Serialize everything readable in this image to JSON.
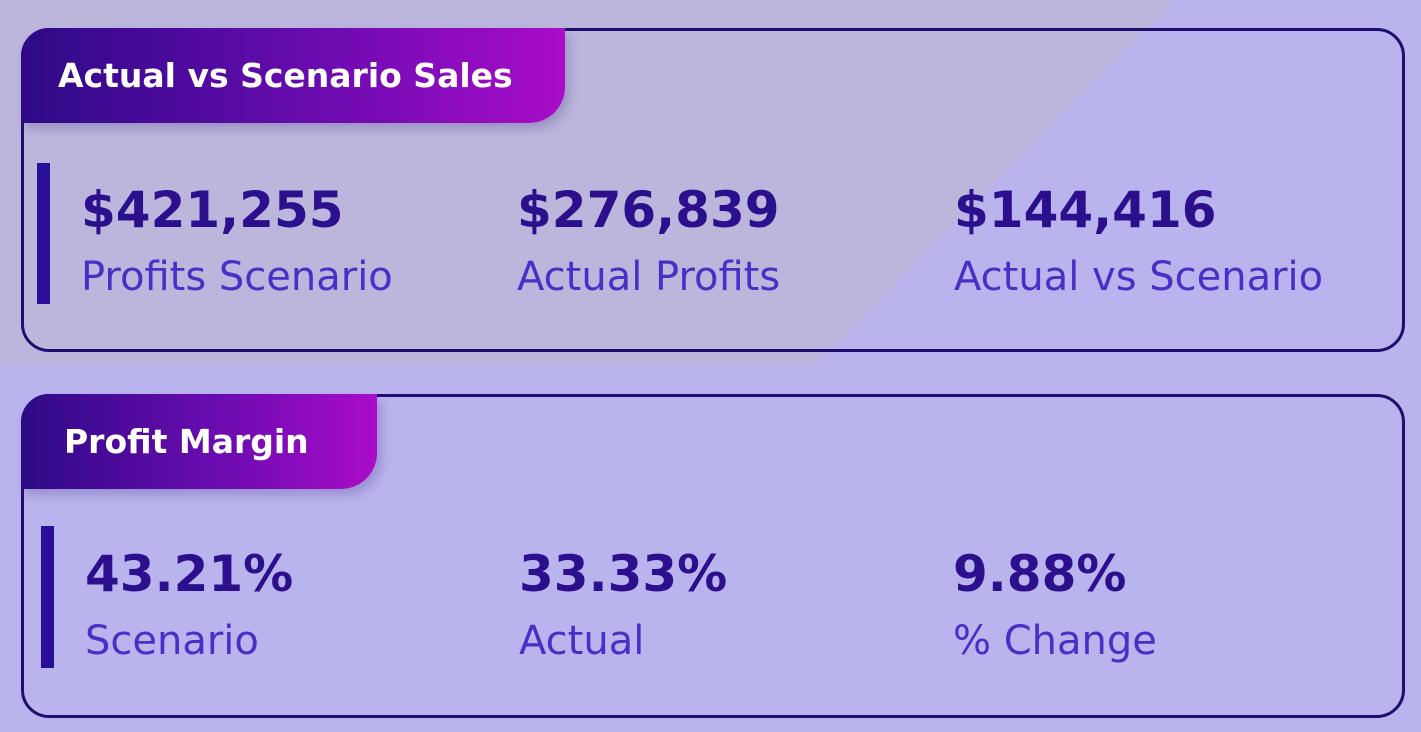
{
  "cards": [
    {
      "title": "Actual vs Scenario Sales",
      "metrics": [
        {
          "value": "$421,255",
          "label": "Profits Scenario"
        },
        {
          "value": "$276,839",
          "label": "Actual Profits"
        },
        {
          "value": "$144,416",
          "label": "Actual vs Scenario"
        }
      ]
    },
    {
      "title": "Profit Margin",
      "metrics": [
        {
          "value": "43.21%",
          "label": "Scenario"
        },
        {
          "value": "33.33%",
          "label": "Actual"
        },
        {
          "value": "9.88%",
          "label": "% Change"
        }
      ]
    }
  ],
  "colors": {
    "background": "#b9b3ee",
    "border": "#1e0f6e",
    "value_text": "#2c0f8c",
    "label_text": "#4a2fc6",
    "tag_gradient_start": "#2d0a86",
    "tag_gradient_end": "#a90cc8"
  }
}
